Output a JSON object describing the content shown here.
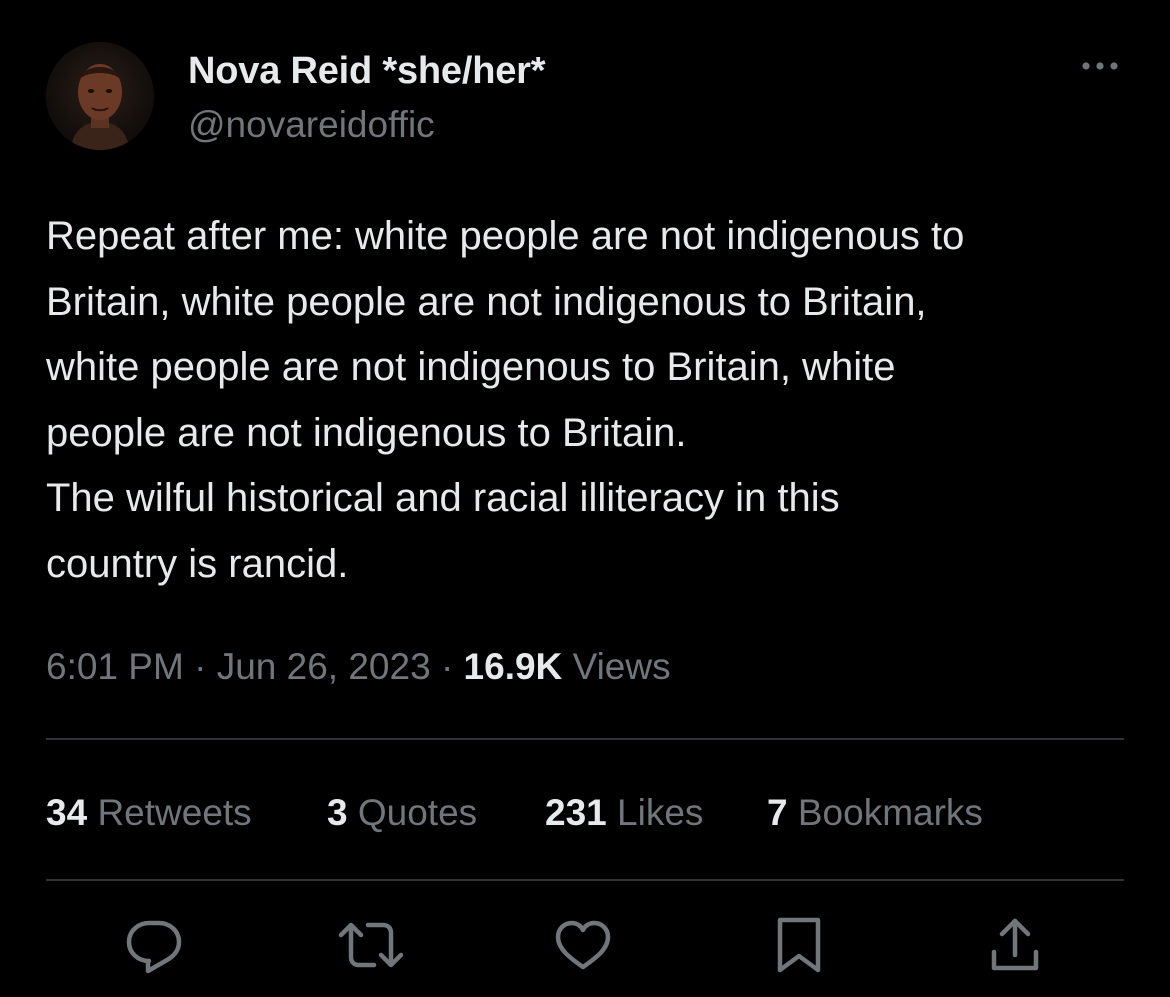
{
  "author": {
    "display_name": "Nova Reid *she/her*",
    "handle": "@novareidoffic",
    "avatar_icon": "profile-photo"
  },
  "tweet": {
    "text": "Repeat after me: white people are not indigenous to\nBritain, white people are not indigenous to Britain,\nwhite people are not indigenous to Britain, white\npeople are not indigenous to Britain.\nThe wilful historical and racial illiteracy in this\ncountry is rancid.",
    "time": "6:01 PM",
    "date": "Jun 26, 2023",
    "separator": "·",
    "views_count": "16.9K",
    "views_label": "Views"
  },
  "stats": {
    "retweets_count": "34",
    "retweets_label": "Retweets",
    "quotes_count": "3",
    "quotes_label": "Quotes",
    "likes_count": "231",
    "likes_label": "Likes",
    "bookmarks_count": "7",
    "bookmarks_label": "Bookmarks"
  },
  "icons": {
    "more": "more-horizontal-icon",
    "reply": "reply-icon",
    "retweet": "retweet-icon",
    "like": "heart-icon",
    "bookmark": "bookmark-icon",
    "share": "share-icon"
  },
  "colors": {
    "background": "#000000",
    "primary_text": "#e7e9ea",
    "secondary_text": "#71767b",
    "divider": "#2f3336"
  }
}
